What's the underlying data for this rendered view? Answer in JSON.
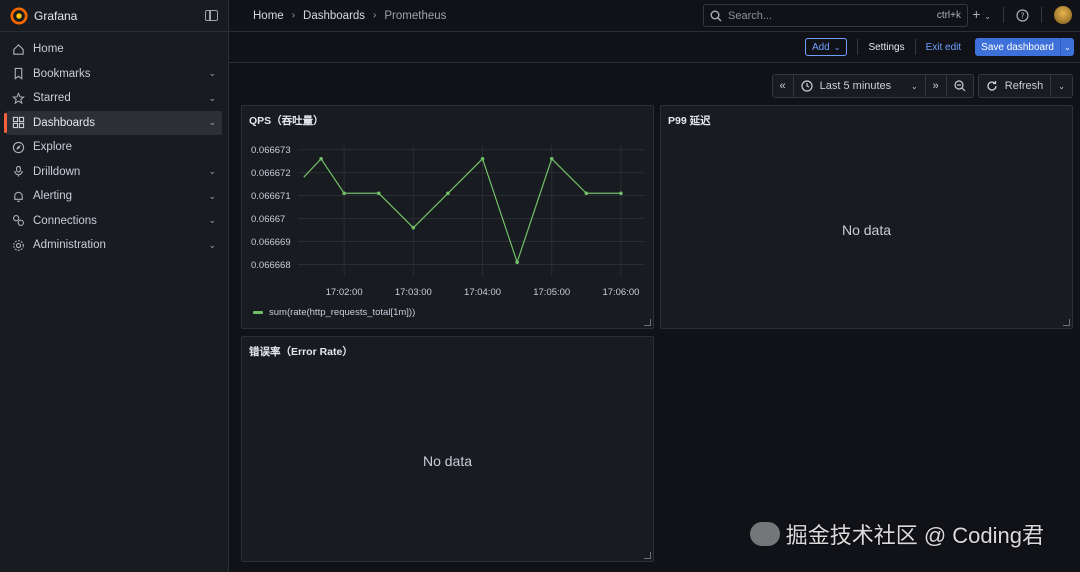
{
  "brand": {
    "name": "Grafana"
  },
  "sidebar": {
    "items": [
      {
        "label": "Home",
        "icon": "home-icon",
        "chev": false,
        "active": false
      },
      {
        "label": "Bookmarks",
        "icon": "bookmark-icon",
        "chev": true,
        "active": false
      },
      {
        "label": "Starred",
        "icon": "star-icon",
        "chev": true,
        "active": false
      },
      {
        "label": "Dashboards",
        "icon": "dashboards-icon",
        "chev": true,
        "active": true
      },
      {
        "label": "Explore",
        "icon": "compass-icon",
        "chev": false,
        "active": false
      },
      {
        "label": "Drilldown",
        "icon": "drilldown-icon",
        "chev": true,
        "active": false
      },
      {
        "label": "Alerting",
        "icon": "bell-icon",
        "chev": true,
        "active": false
      },
      {
        "label": "Connections",
        "icon": "connections-icon",
        "chev": true,
        "active": false
      },
      {
        "label": "Administration",
        "icon": "gear-icon",
        "chev": true,
        "active": false
      }
    ]
  },
  "breadcrumb": [
    "Home",
    "Dashboards",
    "Prometheus"
  ],
  "search": {
    "placeholder": "Search...",
    "shortcut": "ctrl+k"
  },
  "toolbar": {
    "add_label": "Add",
    "settings_label": "Settings",
    "exit_label": "Exit edit",
    "save_label": "Save dashboard"
  },
  "timepicker": {
    "range": "Last 5 minutes",
    "refresh_label": "Refresh"
  },
  "colors": {
    "accent": "#3d71d9",
    "series": "#73bf69",
    "active_marker": "#f55f3e"
  },
  "panels": {
    "qps": {
      "title": "QPS（吞吐量）"
    },
    "p99": {
      "title": "P99 延迟",
      "empty": "No data"
    },
    "err": {
      "title": "错误率（Error Rate）",
      "empty": "No data"
    }
  },
  "chart_data": {
    "type": "line",
    "title": "QPS（吞吐量）",
    "ytick_labels": [
      "0.066673",
      "0.066672",
      "0.066671",
      "0.06667",
      "0.066669",
      "0.066668"
    ],
    "xtick_labels": [
      "17:02:00",
      "17:03:00",
      "17:04:00",
      "17:05:00",
      "17:06:00"
    ],
    "ylim": [
      0.0666675,
      0.0666732
    ],
    "grid": true,
    "legend": "bottom",
    "series": [
      {
        "name": "sum(rate(http_requests_total[1m]))",
        "x": [
          "17:01:25",
          "17:01:40",
          "17:02:00",
          "17:02:30",
          "17:03:00",
          "17:03:30",
          "17:04:00",
          "17:04:30",
          "17:05:00",
          "17:05:30",
          "17:06:00"
        ],
        "values": [
          0.0666718,
          0.0666726,
          0.0666711,
          0.0666711,
          0.0666696,
          0.0666711,
          0.0666726,
          0.0666681,
          0.0666726,
          0.0666711,
          0.0666711
        ]
      }
    ]
  },
  "watermark": "掘金技术社区 @ Coding君"
}
